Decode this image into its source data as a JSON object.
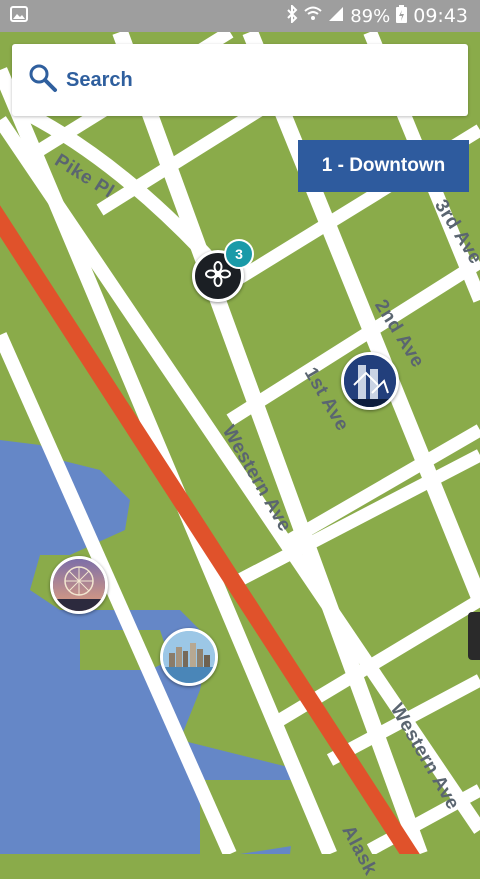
{
  "status_bar": {
    "battery_percent": "89%",
    "time": "09:43",
    "icons": [
      "image-icon",
      "bluetooth-icon",
      "wifi-icon",
      "signal-icon",
      "battery-charging-icon"
    ]
  },
  "search": {
    "label": "Search",
    "icon": "search-icon"
  },
  "tour_button": {
    "label": "1 - Downtown"
  },
  "streets": {
    "pike_pl": "Pike Pl",
    "third_ave": "3rd Ave",
    "second_ave": "2nd Ave",
    "first_ave": "1st Ave",
    "western_ave_1": "Western Ave",
    "western_ave_2": "Western Ave",
    "alaskan": "Alask"
  },
  "map_pins": {
    "cluster_pin": {
      "icon": "flower-icon",
      "count": "3"
    },
    "art_museum_pin": {
      "icon": "art-museum-photo"
    },
    "ferris_wheel_pin": {
      "icon": "ferris-wheel-photo"
    },
    "waterfront_pin": {
      "icon": "waterfront-photo"
    }
  },
  "colors": {
    "land": "#8aab4a",
    "water": "#6587c7",
    "highway": "#e0522b",
    "road": "#ffffff",
    "accent": "#2e5b9e",
    "badge": "#1a9aa8"
  }
}
